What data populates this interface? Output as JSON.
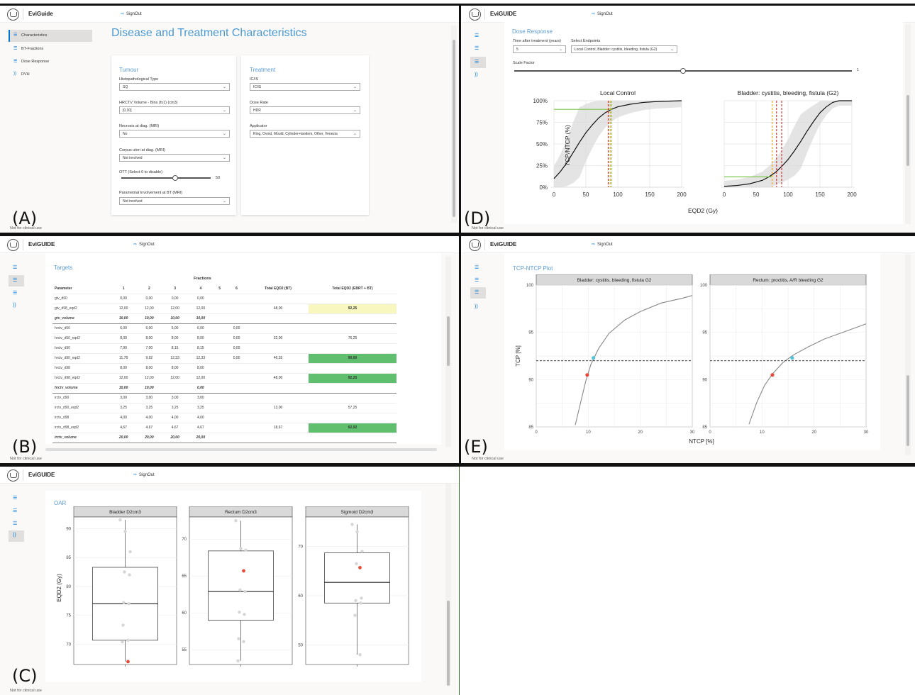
{
  "app": {
    "name_a": "EviGuide",
    "name": "EviGUIDE",
    "signout": "SignOut",
    "footer": "Not for clinical use"
  },
  "panel_letters": [
    "(A)",
    "(B)",
    "(C)",
    "(D)",
    "(E)"
  ],
  "panelA": {
    "nav": [
      {
        "label": "Characteristics",
        "selected": true
      },
      {
        "label": "BT-Fractions"
      },
      {
        "label": "Dose Response"
      },
      {
        "label": "DVH"
      }
    ],
    "page_title": "Disease and Treatment Characteristics",
    "tumour": {
      "title": "Tumour",
      "fields": [
        {
          "label": "Histopathological Type",
          "value": "SQ"
        },
        {
          "label": "HRCTV Volume - Bins (fx1) (cm3)",
          "value": "[0,30]"
        },
        {
          "label": "Necrosis at diag. (MRI)",
          "value": "No"
        },
        {
          "label": "Corpus uteri at diag. (MRI)",
          "value": "Not involved"
        }
      ],
      "ott_label": "OTT (Select 0 to disable)",
      "ott_value": "50",
      "ott_fraction": 0.6,
      "param_label": "Parametrial Involvement at BT (MRI)",
      "param_value": "Not involved"
    },
    "treatment": {
      "title": "Treatment",
      "fields": [
        {
          "label": "IC/IS",
          "value": "IC/IS"
        },
        {
          "label": "Dose Rate",
          "value": "HDR"
        },
        {
          "label": "Applicator",
          "value": "Ring, Ovoid, Mould, Cylinder+tandem, Other, Venezia"
        }
      ]
    }
  },
  "panelB": {
    "title": "Targets",
    "fractions_header": "Fractions",
    "columns": [
      "Parameter",
      "1",
      "2",
      "3",
      "4",
      "5",
      "6",
      "Total EQD2 (BT)",
      "Total EQD2 (EBRT + BT)"
    ],
    "rows": [
      {
        "cells": [
          "gtv_d90",
          "0,00",
          "0,00",
          "0,00",
          "0,00",
          "",
          "",
          "",
          ""
        ]
      },
      {
        "cells": [
          "gtv_d98_eqd2",
          "12,00",
          "12,00",
          "12,00",
          "12,00",
          "",
          "",
          "48,00",
          "92,25"
        ],
        "hl": "y"
      },
      {
        "cells": [
          "gtv_volume",
          "10,00",
          "10,00",
          "10,00",
          "10,00",
          "",
          "",
          "",
          ""
        ],
        "vol": true
      },
      {
        "cells": [
          "hrctv_d50",
          "6,00",
          "6,00",
          "6,00",
          "6,00",
          "",
          "0,00",
          "",
          ""
        ]
      },
      {
        "cells": [
          "hrctv_d50_eqd2",
          "8,00",
          "8,00",
          "8,00",
          "8,00",
          "",
          "0,00",
          "32,00",
          "76,25"
        ]
      },
      {
        "cells": [
          "hrctv_d90",
          "7,90",
          "7,00",
          "8,15",
          "8,15",
          "",
          "0,00",
          "",
          ""
        ]
      },
      {
        "cells": [
          "hrctv_d90_eqd2",
          "11,78",
          "9,92",
          "12,33",
          "12,33",
          "",
          "0,00",
          "46,35",
          "90,60"
        ],
        "hl": "g"
      },
      {
        "cells": [
          "hrctv_d98",
          "8,00",
          "8,00",
          "8,00",
          "8,00",
          "",
          "",
          "",
          ""
        ]
      },
      {
        "cells": [
          "hrctv_d98_eqd2",
          "12,00",
          "12,00",
          "12,00",
          "12,00",
          "",
          "",
          "48,00",
          "92,25"
        ],
        "hl": "g"
      },
      {
        "cells": [
          "hrctv_volume",
          "10,00",
          "10,00",
          "",
          "0,00",
          "",
          "",
          "",
          ""
        ],
        "vol": true
      },
      {
        "cells": [
          "irctv_d90",
          "3,00",
          "3,00",
          "3,00",
          "3,00",
          "",
          "",
          "",
          ""
        ]
      },
      {
        "cells": [
          "irctv_d90_eqd2",
          "3,25",
          "3,25",
          "3,25",
          "3,25",
          "",
          "",
          "13,00",
          "57,25"
        ]
      },
      {
        "cells": [
          "irctv_d98",
          "4,00",
          "4,00",
          "4,00",
          "4,00",
          "",
          "",
          "",
          ""
        ]
      },
      {
        "cells": [
          "irctv_d98_eqd2",
          "4,67",
          "4,67",
          "4,67",
          "4,67",
          "",
          "",
          "18,67",
          "62,92"
        ],
        "hl": "g"
      },
      {
        "cells": [
          "irctv_volume",
          "20,00",
          "20,00",
          "20,00",
          "20,00",
          "",
          "",
          "",
          ""
        ],
        "vol": true
      }
    ]
  },
  "panelD": {
    "title": "Dose Response",
    "time_label": "Time after treatment (years)",
    "time_value": "5",
    "endpoints_label": "Select Endpoints",
    "endpoints_value": "Local Control, Bladder: cystitis, bleeding, fistula (G2)",
    "scale_label": "Scale Factor",
    "scale_value": "1",
    "scale_fraction": 0.5
  },
  "panelE": {
    "title": "TCP-NTCP Plot"
  },
  "panelC": {
    "title": "OAR"
  },
  "chart_data": [
    {
      "type": "line",
      "title": "Local Control",
      "xlabel": "EQD2 (Gy)",
      "ylabel": "TCP/NTCP (%)",
      "xlim": [
        0,
        200
      ],
      "ylim": [
        0,
        100
      ],
      "xticks": [
        "0",
        "50",
        "100",
        "150",
        "200"
      ],
      "yticks": [
        "0%",
        "25%",
        "50%",
        "75%",
        "100%"
      ],
      "series": [
        {
          "x": [
            0,
            10,
            20,
            30,
            40,
            50,
            60,
            70,
            80,
            90,
            100,
            120,
            140,
            160,
            180,
            200
          ],
          "y": [
            10,
            18,
            28,
            40,
            52,
            63,
            72,
            80,
            86,
            90,
            93,
            96,
            98,
            99,
            99.5,
            100
          ]
        }
      ],
      "ci_band": true,
      "vlines": [
        {
          "x": 85,
          "color": "#d62728"
        },
        {
          "x": 88,
          "color": "#ff9900"
        },
        {
          "x": 90,
          "color": "#7cc84a"
        }
      ],
      "hline": {
        "y": 90,
        "color": "#7cc84a"
      },
      "grid": true
    },
    {
      "type": "line",
      "title": "Bladder: cystitis, bleeding, fistula (G2)",
      "xlabel": "EQD2 (Gy)",
      "xlim": [
        0,
        200
      ],
      "ylim": [
        0,
        100
      ],
      "xticks": [
        "0",
        "50",
        "100",
        "150",
        "200"
      ],
      "series": [
        {
          "x": [
            0,
            20,
            40,
            60,
            70,
            80,
            90,
            100,
            110,
            120,
            130,
            140,
            150,
            160,
            170,
            180,
            200
          ],
          "y": [
            1,
            2,
            4,
            8,
            12,
            17,
            24,
            32,
            42,
            53,
            65,
            76,
            86,
            93,
            98,
            100,
            100
          ]
        }
      ],
      "ci_band": true,
      "vlines": [
        {
          "x": 75,
          "color": "#ff9900"
        },
        {
          "x": 82,
          "color": "#d62728"
        },
        {
          "x": 90,
          "color": "#d62728"
        }
      ],
      "hline": {
        "y": 12,
        "color": "#7cc84a"
      },
      "grid": true
    },
    {
      "type": "line",
      "title": "Bladder: cystitis, bleeding, fistula G2",
      "xlabel": "NTCP [%]",
      "ylabel": "TCP [%]",
      "xlim": [
        0,
        30
      ],
      "ylim": [
        85,
        100
      ],
      "xticks": [
        "0",
        "10",
        "20",
        "30"
      ],
      "yticks": [
        "85",
        "90",
        "95",
        "100"
      ],
      "series": [
        {
          "x": [
            7.5,
            8.5,
            9.5,
            10.5,
            12,
            14,
            17,
            20,
            24,
            28,
            30
          ],
          "y": [
            85.2,
            87.5,
            89.8,
            91.6,
            93.3,
            94.9,
            96.3,
            97.2,
            98.1,
            98.6,
            98.9
          ]
        }
      ],
      "hline": {
        "y": 92,
        "style": "dashed"
      },
      "points": [
        {
          "x": 9.8,
          "y": 90.5,
          "color": "#e74c3c"
        },
        {
          "x": 11,
          "y": 92.3,
          "color": "#4fc3d9"
        }
      ],
      "grid": true
    },
    {
      "type": "line",
      "title": "Rectum: proctitis, A/R bleeding G2",
      "xlabel": "NTCP [%]",
      "xlim": [
        0,
        30
      ],
      "ylim": [
        85,
        100
      ],
      "xticks": [
        "0",
        "10",
        "20",
        "30"
      ],
      "yticks": [
        "85",
        "90",
        "95",
        "100"
      ],
      "series": [
        {
          "x": [
            7.5,
            9,
            10.5,
            12,
            14,
            16,
            19,
            22,
            26,
            30
          ],
          "y": [
            85.3,
            87.6,
            89.4,
            90.6,
            91.8,
            92.6,
            93.5,
            94.3,
            95.1,
            95.9
          ]
        }
      ],
      "hline": {
        "y": 92,
        "style": "dashed"
      },
      "points": [
        {
          "x": 12,
          "y": 90.5,
          "color": "#e74c3c"
        },
        {
          "x": 15.8,
          "y": 92.3,
          "color": "#4fc3d9"
        }
      ],
      "grid": true
    },
    {
      "type": "box",
      "title": "Bladder D2cm3",
      "ylabel": "EQD2 (Gy)",
      "ylim": [
        66.5,
        92
      ],
      "yticks": [
        70,
        75,
        80,
        85,
        90
      ],
      "box": {
        "q1": 70.7,
        "median": 77,
        "q3": 83.3,
        "min": 67,
        "max": 91.5
      },
      "points": [
        91.5,
        89.5,
        86,
        82.5,
        82,
        77.2,
        77,
        73.3,
        70.7,
        70.4
      ],
      "highlight": 67
    },
    {
      "type": "box",
      "title": "Rectum D2cm3",
      "ylim": [
        53,
        73
      ],
      "yticks": [
        55,
        60,
        65,
        70
      ],
      "box": {
        "q1": 59,
        "median": 62.9,
        "q3": 68.4,
        "min": 53.5,
        "max": 72.5
      },
      "points": [
        72.5,
        68.7,
        68.5,
        63.1,
        62.9,
        60.1,
        59.8,
        56.5,
        56.1,
        53.5
      ],
      "highlight": 65.7
    },
    {
      "type": "box",
      "title": "Sigmoid D2cm3",
      "ylim": [
        46,
        76
      ],
      "yticks": [
        50,
        60,
        70
      ],
      "box": {
        "q1": 58.5,
        "median": 62.7,
        "q3": 68.7,
        "min": 48,
        "max": 74.5
      },
      "points": [
        74.5,
        73,
        69,
        66.5,
        59.5,
        59,
        58.5,
        56,
        48
      ],
      "highlight": 65.7
    }
  ]
}
